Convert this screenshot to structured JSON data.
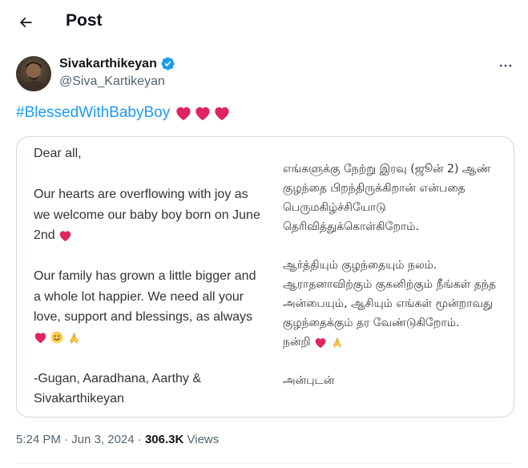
{
  "header": {
    "title": "Post"
  },
  "author": {
    "name": "Sivakarthikeyan",
    "handle": "@Siva_Kartikeyan",
    "verified": true
  },
  "tweet": {
    "hashtag": "#BlessedWithBabyBoy",
    "heart_count": 3,
    "heart_color": "#e0245e",
    "link_color": "#1d9bf0"
  },
  "letter": {
    "english": {
      "greeting": "Dear all,",
      "para1": "Our hearts are overflowing with joy as we welcome our baby boy born on June 2nd",
      "para2": "Our family has grown a little bigger and a whole lot happier. We need all your love, support and blessings, as always",
      "signature": "-Gugan, Aaradhana, Aarthy & Sivakarthikeyan"
    },
    "tamil": {
      "para1": "எங்களுக்கு நேற்று இரவு (ஜூன் 2) ஆண் குழந்தை பிறந்திருக்கிறான் என்பதை பெருமகிழ்ச்சியோடு தெரிவித்துக்கொள்கிறோம்.",
      "para2": "ஆர்த்தியும் குழந்தையும் நலம். ஆராதனாவிற்கும் குகனிற்கும் நீங்கள் தந்த அன்பையும், ஆசியும் எங்கள் மூன்றாவது குழந்தைக்கும் தர வேண்டுகிறோம்.",
      "thanks": "நன்றி",
      "closing": "அன்புடன்"
    }
  },
  "meta": {
    "time": "5:24 PM",
    "separator1": " · ",
    "date": "Jun 3, 2024",
    "separator2": " · ",
    "views_count": "306.3K",
    "views_label": " Views"
  }
}
